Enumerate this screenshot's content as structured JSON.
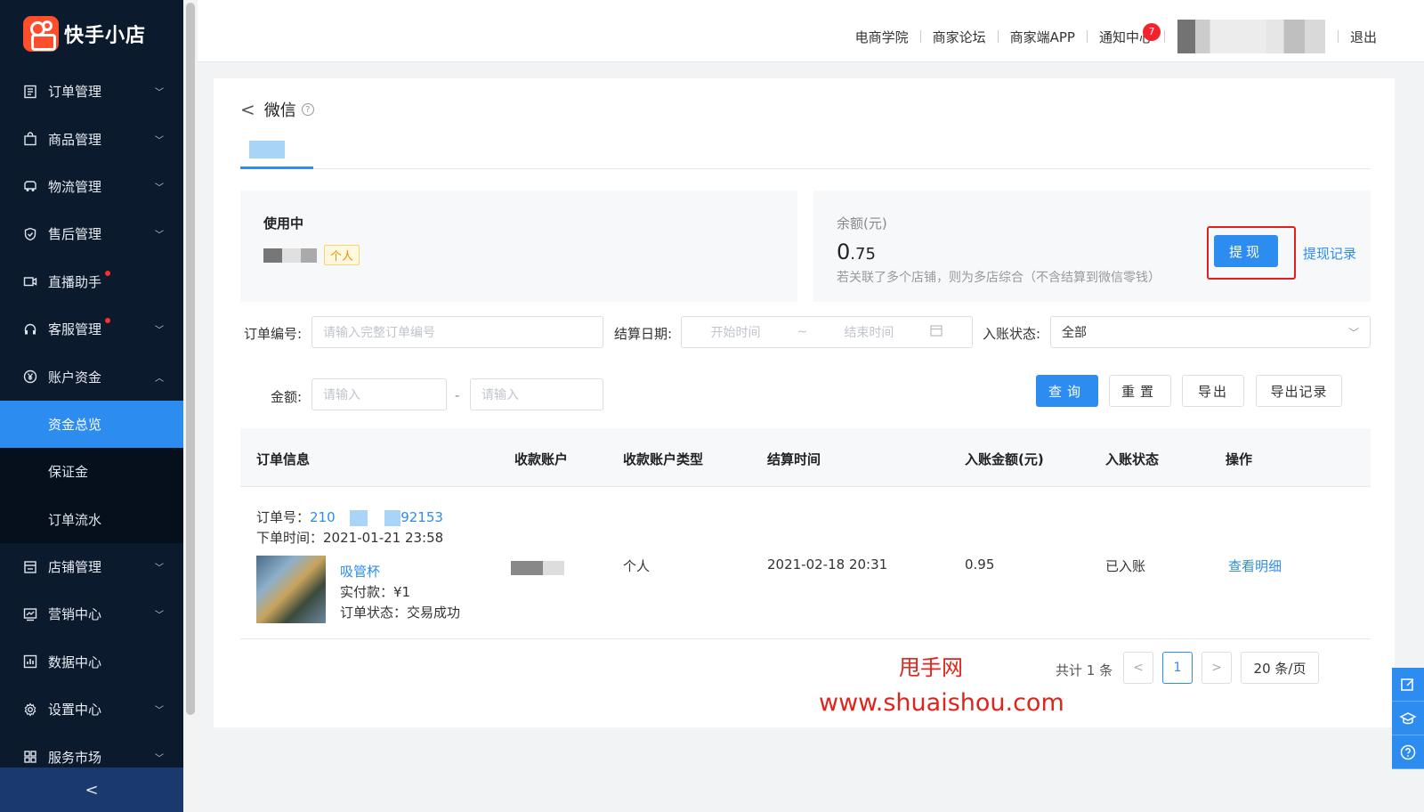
{
  "app": {
    "logo_text": "快手小店"
  },
  "sidebar": {
    "items": [
      {
        "label": "订单管理",
        "icon": "order-icon",
        "expandable": true
      },
      {
        "label": "商品管理",
        "icon": "bag-icon",
        "expandable": true
      },
      {
        "label": "物流管理",
        "icon": "truck-icon",
        "expandable": true
      },
      {
        "label": "售后管理",
        "icon": "shield-icon",
        "expandable": true
      },
      {
        "label": "直播助手",
        "icon": "video-icon",
        "red_dot": true
      },
      {
        "label": "客服管理",
        "icon": "headset-icon",
        "expandable": true,
        "red_dot": true
      },
      {
        "label": "账户资金",
        "icon": "yen-icon",
        "expanded": true
      }
    ],
    "sub_items": [
      {
        "label": "资金总览",
        "active": true
      },
      {
        "label": "保证金"
      },
      {
        "label": "订单流水"
      }
    ],
    "items_after": [
      {
        "label": "店铺管理",
        "icon": "store-icon",
        "expandable": true
      },
      {
        "label": "营销中心",
        "icon": "chart-icon",
        "expandable": true
      },
      {
        "label": "数据中心",
        "icon": "data-icon"
      },
      {
        "label": "设置中心",
        "icon": "gear-icon",
        "expandable": true
      },
      {
        "label": "服务市场",
        "icon": "grid-icon",
        "expandable": true
      }
    ],
    "collapse": "<"
  },
  "topbar": {
    "links": [
      "电商学院",
      "商家论坛",
      "商家端APP",
      "通知中心"
    ],
    "notify_count": "7",
    "logout": "退出"
  },
  "page": {
    "title": "微信",
    "account": {
      "status_title": "使用中",
      "type_tag": "个人"
    },
    "balance": {
      "label": "余额(元)",
      "amount_int": "0",
      "amount_dec": ".75",
      "note": "若关联了多个店铺，则为多店综合（不含结算到微信零钱）",
      "withdraw_label": "提现",
      "record_link": "提现记录"
    },
    "filters": {
      "order_no_label": "订单编号:",
      "order_no_placeholder": "请输入完整订单编号",
      "date_label": "结算日期:",
      "date_start": "开始时间",
      "date_sep": "~",
      "date_end": "结束时间",
      "status_label": "入账状态:",
      "status_value": "全部",
      "amount_label": "金额:",
      "amount_min_placeholder": "请输入",
      "amount_sep": "-",
      "amount_max_placeholder": "请输入",
      "btn_query": "查询",
      "btn_reset": "重置",
      "btn_export": "导出",
      "btn_export_record": "导出记录"
    },
    "table": {
      "headers": [
        "订单信息",
        "收款账户",
        "收款账户类型",
        "结算时间",
        "入账金额(元)",
        "入账状态",
        "操作"
      ],
      "rows": [
        {
          "order_no_label": "订单号：",
          "order_no_prefix": "210",
          "order_no_suffix": "92153",
          "order_time_label": "下单时间：",
          "order_time": "2021-01-21 23:58",
          "product_name": "吸管杯",
          "paid_label": "实付款：",
          "paid": "¥1",
          "order_status_label": "订单状态：",
          "order_status": "交易成功",
          "account_type": "个人",
          "settle_time": "2021-02-18 20:31",
          "amount": "0.95",
          "status": "已入账",
          "action": "查看明细"
        }
      ]
    },
    "pagination": {
      "total_text": "共计 1 条",
      "prev": "<",
      "current": "1",
      "next": ">",
      "page_size": "20 条/页"
    }
  },
  "watermark": {
    "line1": "甩手网",
    "line2": "www.shuaishou.com"
  },
  "colors": {
    "primary": "#2d8cf0",
    "sidebar_bg": "#0c1a2e",
    "highlight_red": "#e02020"
  }
}
